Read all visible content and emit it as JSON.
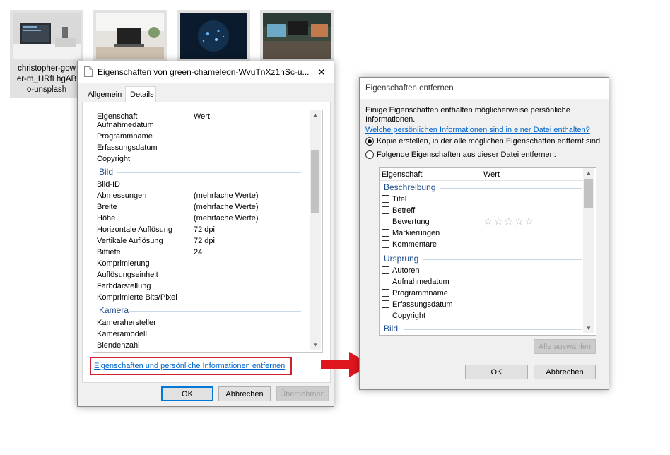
{
  "desktop": {
    "selected_file_caption": [
      "christopher-gow",
      "er-m_HRfLhgAB",
      "o-unsplash"
    ]
  },
  "properties_dialog": {
    "title": "Eigenschaften von green-chameleon-WvuTnXz1hSc-u...",
    "close_glyph": "✕",
    "tabs": [
      {
        "label": "Allgemein",
        "active": false
      },
      {
        "label": "Details",
        "active": true
      }
    ],
    "header": {
      "property": "Eigenschaft",
      "value": "Wert"
    },
    "rows_top": [
      "Aufnahmedatum",
      "Programmname",
      "Erfassungsdatum",
      "Copyright"
    ],
    "group_bild": "Bild",
    "rows_bild": [
      {
        "name": "Bild-ID",
        "value": ""
      },
      {
        "name": "Abmessungen",
        "value": "(mehrfache Werte)"
      },
      {
        "name": "Breite",
        "value": "(mehrfache Werte)"
      },
      {
        "name": "Höhe",
        "value": "(mehrfache Werte)"
      },
      {
        "name": "Horizontale Auflösung",
        "value": "72 dpi"
      },
      {
        "name": "Vertikale Auflösung",
        "value": "72 dpi"
      },
      {
        "name": "Bittiefe",
        "value": "24"
      },
      {
        "name": "Komprimierung",
        "value": ""
      },
      {
        "name": "Auflösungseinheit",
        "value": ""
      },
      {
        "name": "Farbdarstellung",
        "value": ""
      },
      {
        "name": "Komprimierte Bits/Pixel",
        "value": ""
      }
    ],
    "group_kamera": "Kamera",
    "rows_kamera": [
      "Kamerahersteller",
      "Kameramodell",
      "Blendenzahl"
    ],
    "remove_link": "Eigenschaften und persönliche Informationen entfernen",
    "buttons": {
      "ok": "OK",
      "cancel": "Abbrechen",
      "apply": "Übernehmen"
    }
  },
  "remove_dialog": {
    "title": "Eigenschaften entfernen",
    "description": "Einige Eigenschaften enthalten möglicherweise persönliche Informationen.",
    "info_link": "Welche persönlichen Informationen sind in einer Datei enthalten?",
    "option_copy": "Kopie erstellen, in der alle möglichen Eigenschaften entfernt sind",
    "option_remove": "Folgende Eigenschaften aus dieser Datei entfernen:",
    "selected_option": "copy",
    "header": {
      "property": "Eigenschaft",
      "value": "Wert"
    },
    "group_beschreibung": "Beschreibung",
    "rows_beschreibung": [
      "Titel",
      "Betreff",
      "Bewertung",
      "Markierungen",
      "Kommentare"
    ],
    "rating_stars": "☆☆☆☆☆",
    "group_ursprung": "Ursprung",
    "rows_ursprung": [
      "Autoren",
      "Aufnahmedatum",
      "Programmname",
      "Erfassungsdatum",
      "Copyright"
    ],
    "group_bild": "Bild",
    "buttons": {
      "select_all": "Alle auswählen",
      "ok": "OK",
      "cancel": "Abbrechen"
    }
  },
  "colors": {
    "highlight_box": "#d0202a",
    "arrow": "#e0161e",
    "link": "#0066cc",
    "group_text": "#1e4e8c"
  }
}
